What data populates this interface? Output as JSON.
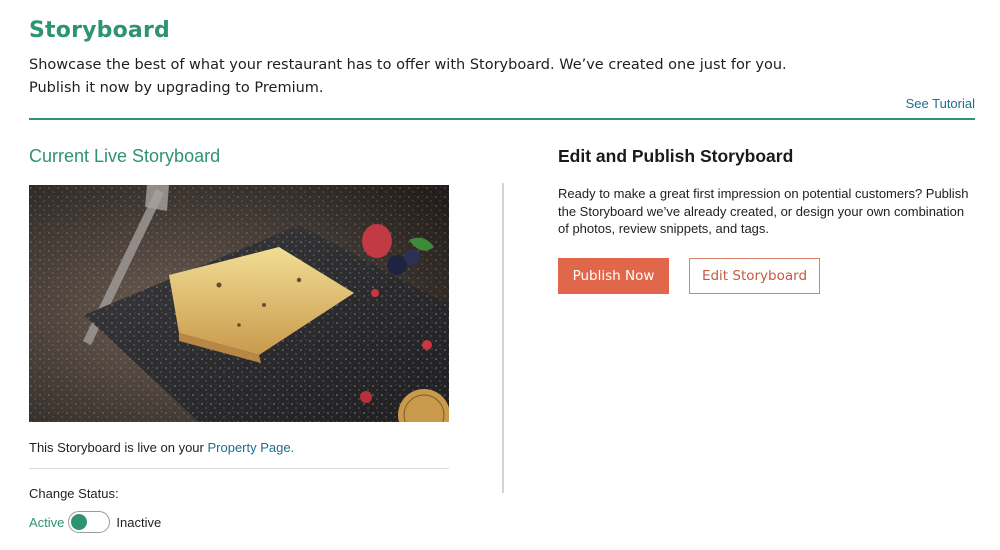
{
  "header": {
    "title": "Storyboard",
    "intro_line1": "Showcase the best of what your restaurant has to offer with Storyboard. We’ve created one just for you.",
    "intro_line2": "Publish it now by upgrading to Premium.",
    "tutorial_link": "See Tutorial",
    "accent_color": "#2e9275"
  },
  "current": {
    "title": "Current Live Storyboard",
    "live_text": "This Storyboard is live on your",
    "property_link": "Property Page.",
    "status_label": "Change Status:",
    "toggle_active_label": "Active",
    "toggle_inactive_label": "Inactive",
    "toggle_state": "active"
  },
  "publish": {
    "title": "Edit and Publish Storyboard",
    "description": "Ready to make a great first impression on potential customers? Publish the Storyboard we’ve already created, or design your own combination of photos, review snippets, and tags.",
    "publish_button": "Publish Now",
    "edit_button": "Edit Storyboard",
    "button_color": "#e0674a"
  }
}
